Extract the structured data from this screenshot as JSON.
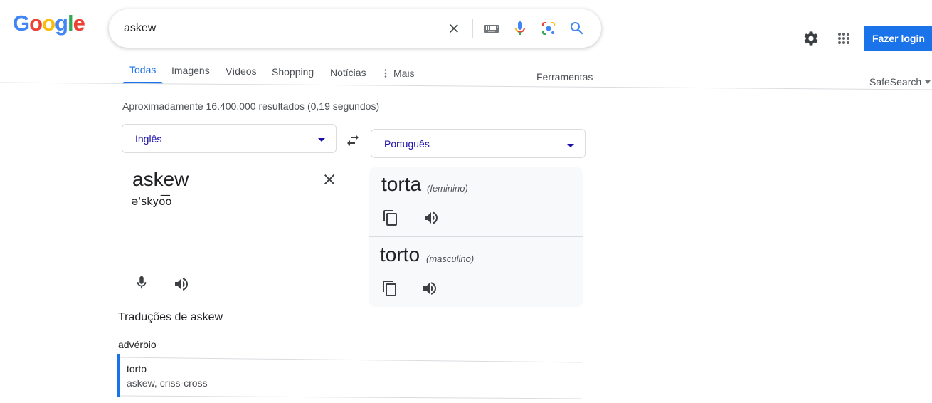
{
  "logo": {
    "letters": [
      "G",
      "o",
      "o",
      "g",
      "l",
      "e"
    ],
    "colors": [
      "#4285F4",
      "#EA4335",
      "#FBBC05",
      "#4285F4",
      "#34A853",
      "#EA4335"
    ]
  },
  "search": {
    "query": "askew"
  },
  "header": {
    "login_label": "Fazer login"
  },
  "tabs": [
    {
      "label": "Todas",
      "active": true
    },
    {
      "label": "Imagens"
    },
    {
      "label": "Vídeos"
    },
    {
      "label": "Shopping"
    },
    {
      "label": "Notícias"
    },
    {
      "label": "Mais"
    }
  ],
  "tools_label": "Ferramentas",
  "safesearch_label": "SafeSearch",
  "result_stats": "Aproximadamente 16.400.000 resultados (0,19 segundos)",
  "translator": {
    "source_lang": "Inglês",
    "target_lang": "Português",
    "source_word": "askew",
    "source_phonetic": "əˈskyo͞o",
    "translations": [
      {
        "word": "torta",
        "gender": "(feminino)"
      },
      {
        "word": "torto",
        "gender": "(masculino)"
      }
    ]
  },
  "translations_section": {
    "title": "Traduções de askew",
    "part_of_speech": "advérbio",
    "entries": [
      {
        "word": "torto",
        "synonyms": "askew, criss-cross"
      }
    ]
  },
  "colors": {
    "accent": "#1a73e8",
    "link": "#1a0dab"
  }
}
